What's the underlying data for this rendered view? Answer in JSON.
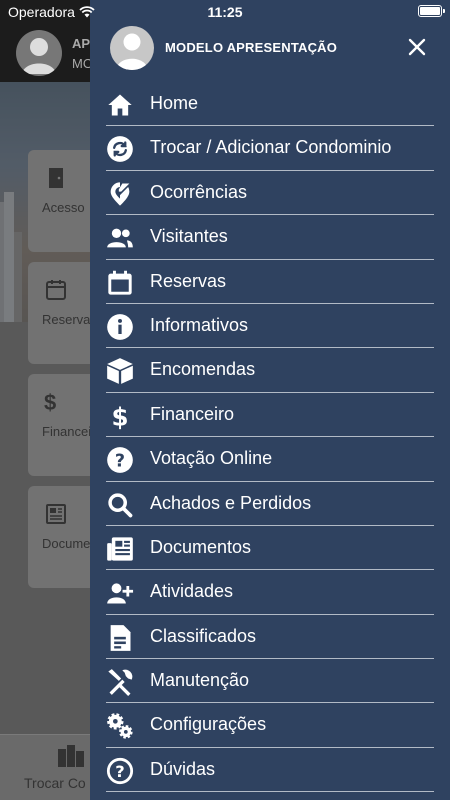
{
  "status_bar": {
    "carrier": "Operadora",
    "time": "11:25"
  },
  "background": {
    "header_line1": "AP",
    "header_line2": "MO",
    "cards": [
      {
        "label": "Acesso",
        "icon": "door-icon"
      },
      {
        "label": "Reservas",
        "icon": "calendar-icon"
      },
      {
        "label": "Financeiro",
        "icon": "dollar-icon"
      },
      {
        "label": "Documentos",
        "icon": "newspaper-icon"
      }
    ],
    "bottom_label": "Trocar Co"
  },
  "drawer": {
    "user_name": "MODELO APRESENTAÇÃO",
    "items": [
      {
        "label": "Home",
        "icon": "home-icon"
      },
      {
        "label": "Trocar / Adicionar Condominio",
        "icon": "sync-icon"
      },
      {
        "label": "Ocorrências",
        "icon": "pin-edit-icon"
      },
      {
        "label": "Visitantes",
        "icon": "users-icon"
      },
      {
        "label": "Reservas",
        "icon": "calendar-icon"
      },
      {
        "label": "Informativos",
        "icon": "info-icon"
      },
      {
        "label": "Encomendas",
        "icon": "box-icon"
      },
      {
        "label": "Financeiro",
        "icon": "dollar-icon"
      },
      {
        "label": "Votação Online",
        "icon": "question-icon"
      },
      {
        "label": "Achados e Perdidos",
        "icon": "search-icon"
      },
      {
        "label": "Documentos",
        "icon": "newspaper-icon"
      },
      {
        "label": "Atividades",
        "icon": "user-plus-icon"
      },
      {
        "label": "Classificados",
        "icon": "document-icon"
      },
      {
        "label": "Manutenção",
        "icon": "tools-icon"
      },
      {
        "label": "Configurações",
        "icon": "gears-icon"
      },
      {
        "label": "Dúvidas",
        "icon": "help-circle-icon"
      }
    ]
  },
  "colors": {
    "drawer_bg": "#2f4260",
    "text": "#ffffff",
    "divider": "#c9cfd8"
  }
}
